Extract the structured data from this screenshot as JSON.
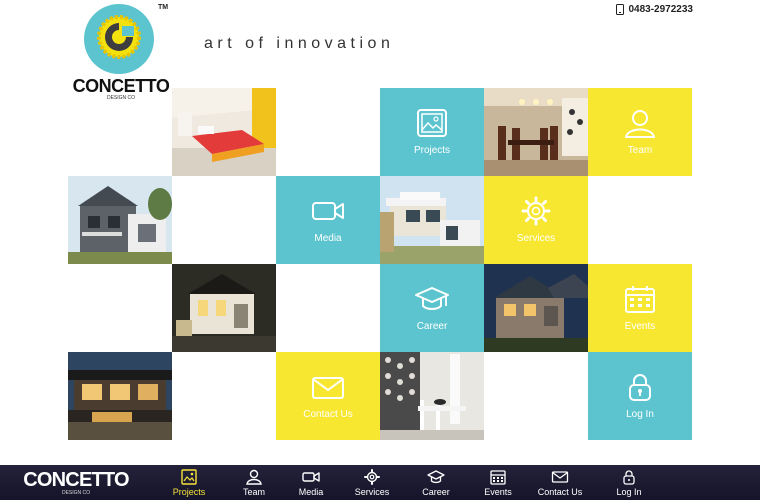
{
  "brand": {
    "name": "CONCETTO",
    "subtitle": "DESIGN CO",
    "trademark": "TM",
    "tagline": "art of innovation",
    "colors": {
      "teal": "#5cc4ce",
      "yellow": "#f8e731",
      "navbar": "#1c1b31",
      "active": "#f7e23a"
    }
  },
  "contact": {
    "phone": "0483-2972233",
    "icon": "mobile-phone-icon"
  },
  "tiles": {
    "projects": {
      "label": "Projects",
      "icon": "picture-icon"
    },
    "team": {
      "label": "Team",
      "icon": "person-icon"
    },
    "media": {
      "label": "Media",
      "icon": "video-camera-icon"
    },
    "services": {
      "label": "Services",
      "icon": "gear-icon"
    },
    "career": {
      "label": "Career",
      "icon": "graduation-cap-icon"
    },
    "events": {
      "label": "Events",
      "icon": "calendar-icon"
    },
    "contact": {
      "label": "Contact Us",
      "icon": "envelope-icon"
    },
    "login": {
      "label": "Log In",
      "icon": "lock-icon"
    }
  },
  "navbar": {
    "items": [
      {
        "label": "Projects",
        "icon": "picture-icon",
        "active": true
      },
      {
        "label": "Team",
        "icon": "person-icon"
      },
      {
        "label": "Media",
        "icon": "video-camera-icon"
      },
      {
        "label": "Services",
        "icon": "gear-icon"
      },
      {
        "label": "Career",
        "icon": "graduation-cap-icon"
      },
      {
        "label": "Events",
        "icon": "calendar-icon"
      },
      {
        "label": "Contact Us",
        "icon": "envelope-icon"
      },
      {
        "label": "Log In",
        "icon": "lock-icon"
      }
    ]
  }
}
